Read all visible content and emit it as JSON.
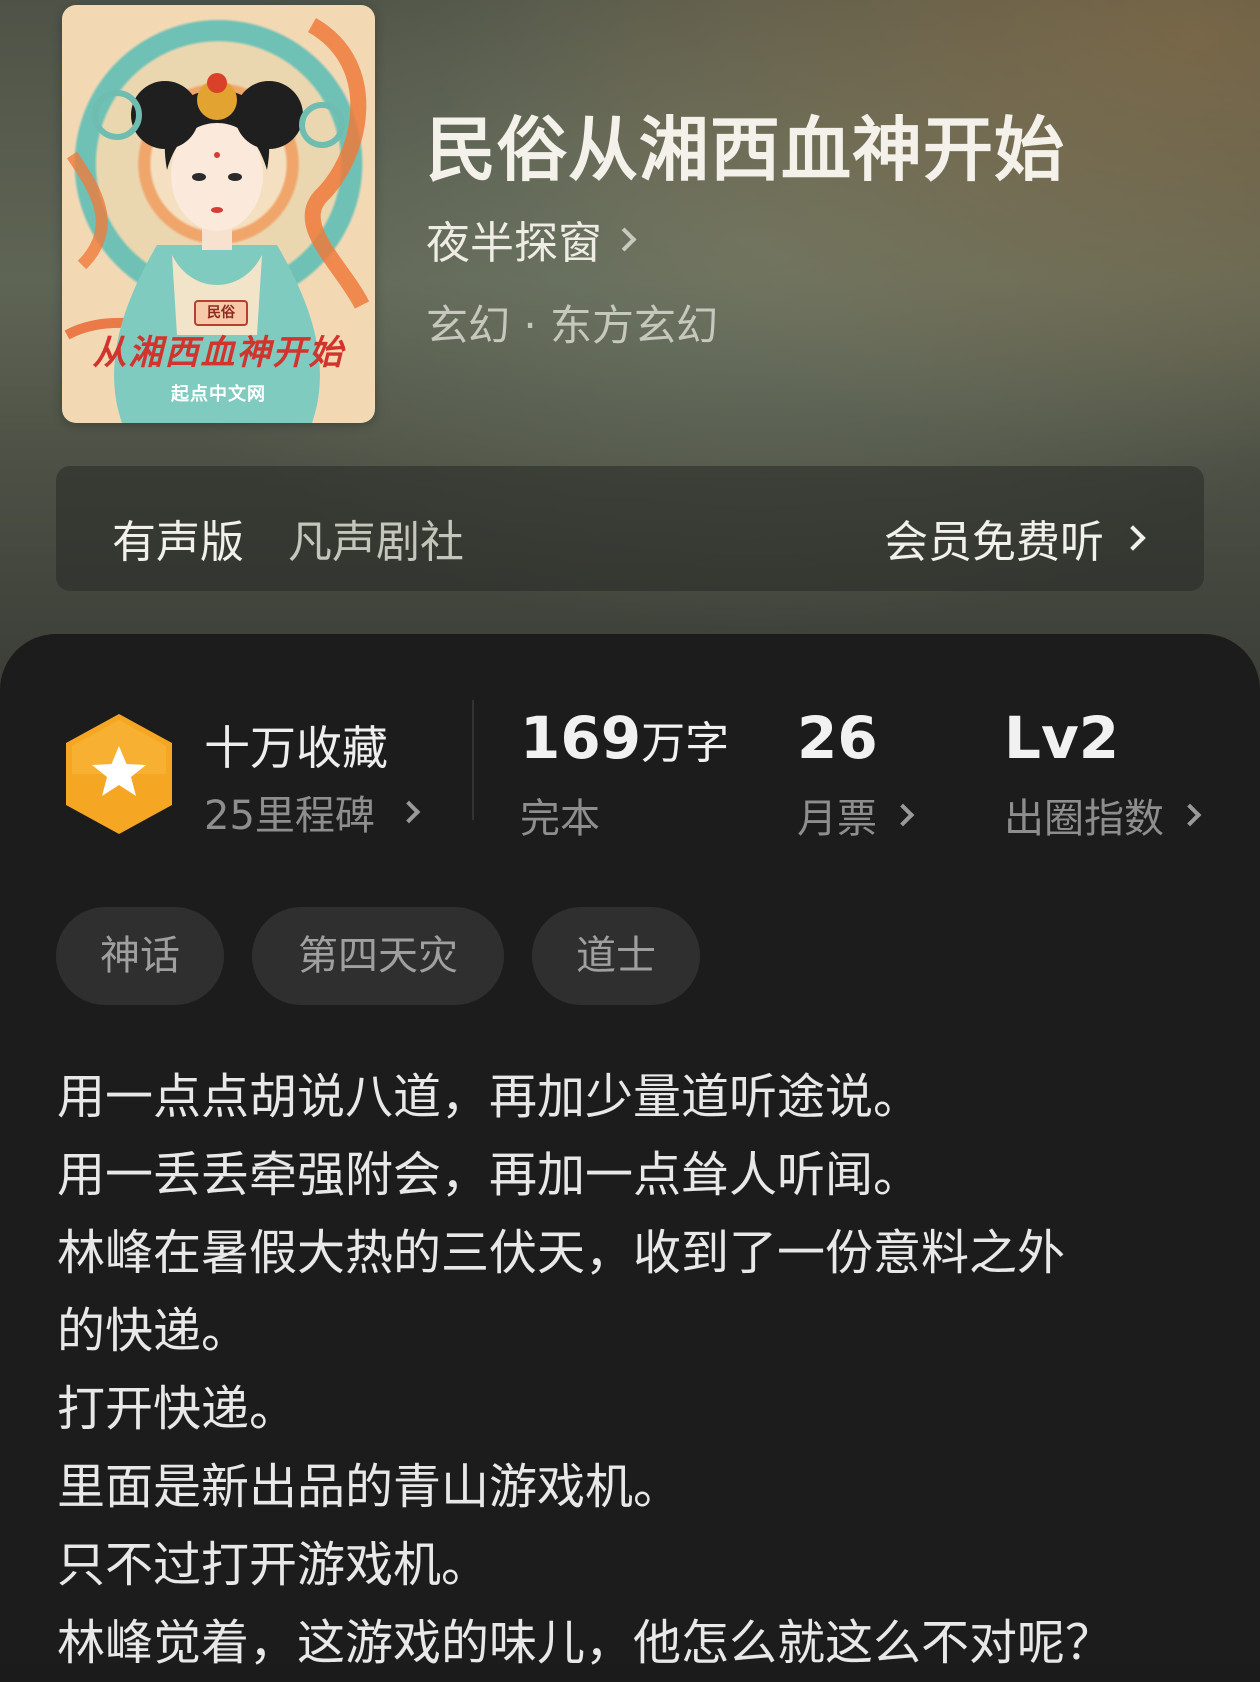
{
  "book": {
    "title": "民俗从湘西血神开始",
    "author": "夜半探窗",
    "genre": "玄幻 · 东方玄幻"
  },
  "cover": {
    "tag": "民俗",
    "title": "从湘西血神开始",
    "publisher": "起点中文网"
  },
  "audio": {
    "label": "有声版",
    "studio": "凡声剧社",
    "action": "会员免费听"
  },
  "stats": {
    "favorites": "十万收藏",
    "milestones": "25里程碑",
    "word_count_num": "169",
    "word_count_unit": "万字",
    "status": "完本",
    "monthly_votes": "26",
    "monthly_votes_label": "月票",
    "level": "Lv2",
    "level_label": "出圈指数"
  },
  "tags": [
    "神话",
    "第四天灾",
    "道士"
  ],
  "description": [
    "用一点点胡说八道，再加少量道听途说。",
    "用一丢丢牵强附会，再加一点耸人听闻。",
    "林峰在暑假大热的三伏天，收到了一份意料之外",
    "的快递。",
    "打开快递。",
    "里面是新出品的青山游戏机。",
    "只不过打开游戏机。",
    "林峰觉着，这游戏的味儿，他怎么就这么不对呢？"
  ],
  "colors": {
    "badge": "#f5a623",
    "panel": "#1c1c1c"
  }
}
